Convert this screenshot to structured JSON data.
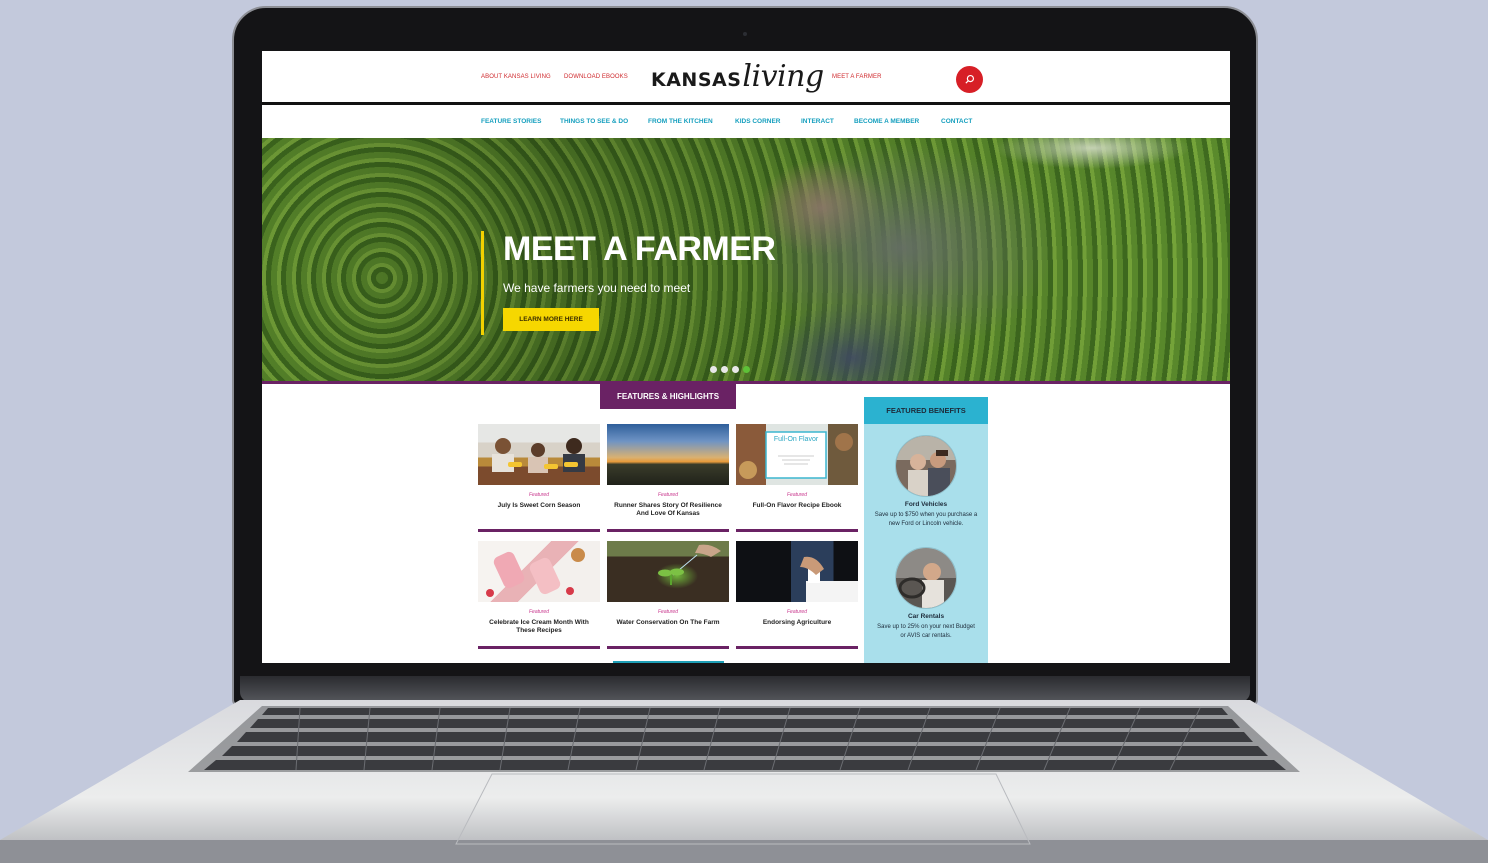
{
  "header": {
    "links_left": [
      "ABOUT KANSAS LIVING",
      "DOWNLOAD EBOOKS"
    ],
    "logo": {
      "kansas": "KANSAS",
      "living": "living"
    },
    "links_right": [
      "MEET A FARMER"
    ],
    "search_icon": "search-icon",
    "accent": "#d71f26"
  },
  "nav": {
    "items": [
      "FEATURE STORIES",
      "THINGS TO SEE & DO",
      "FROM THE KITCHEN",
      "KIDS CORNER",
      "INTERACT",
      "BECOME A MEMBER",
      "CONTACT"
    ],
    "color": "#159fbe"
  },
  "hero": {
    "title": "MEET A FARMER",
    "subtitle": "We have farmers you need to meet",
    "button": "LEARN MORE HERE",
    "slides": 4,
    "active_slide": 4,
    "button_color": "#f6d700"
  },
  "features": {
    "heading": "FEATURES & HIGHLIGHTS",
    "cards": [
      {
        "tag": "Featured",
        "title": "July Is Sweet Corn Season"
      },
      {
        "tag": "Featured",
        "title": "Runner Shares Story Of Resilience And Love Of Kansas"
      },
      {
        "tag": "Featured",
        "title": "Full-On Flavor Recipe Ebook"
      },
      {
        "tag": "Featured",
        "title": "Celebrate Ice Cream Month With These Recipes"
      },
      {
        "tag": "Featured",
        "title": "Water Conservation On The Farm"
      },
      {
        "tag": "Featured",
        "title": "Endorsing Agriculture"
      }
    ],
    "ebook_cover_title": "Full-On Flavor",
    "accent": "#6a2264"
  },
  "benefits": {
    "heading": "FEATURED BENEFITS",
    "items": [
      {
        "title": "Ford Vehicles",
        "desc": "Save up to $750 when you purchase a new Ford or Lincoln vehicle."
      },
      {
        "title": "Car Rentals",
        "desc": "Save up to 25% on your next Budget or AVIS car rentals."
      }
    ],
    "color": "#a9dfeb"
  }
}
